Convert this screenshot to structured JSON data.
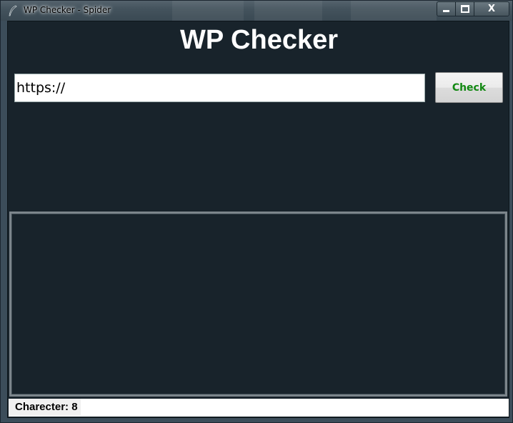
{
  "window": {
    "title": "WP Checker - Spider",
    "close_symbol": "X",
    "icons": {
      "app": "feather-icon",
      "minimize": "minimize-icon",
      "maximize": "maximize-icon",
      "close": "close-icon"
    }
  },
  "header": {
    "title": "WP Checker"
  },
  "url_input": {
    "value": "https://"
  },
  "check_button": {
    "label": "Check",
    "text_color": "#118811"
  },
  "output": {
    "content": ""
  },
  "status_bar": {
    "label": "Charecter: 8"
  },
  "colors": {
    "background": "#18232b",
    "title": "#ffffff"
  }
}
